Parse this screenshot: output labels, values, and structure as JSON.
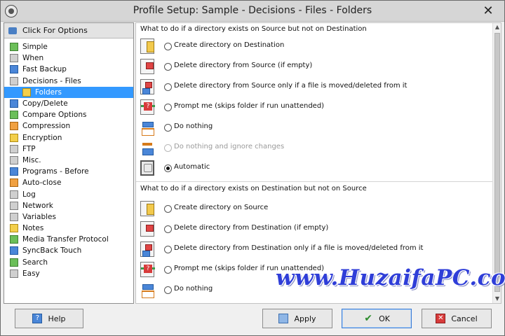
{
  "window": {
    "title": "Profile Setup: Sample - Decisions - Files - Folders",
    "close_glyph": "✕"
  },
  "sidebar": {
    "header": "Click For Options",
    "items": [
      {
        "label": "Simple",
        "icon": "simple-icon",
        "color": "green"
      },
      {
        "label": "When",
        "icon": "clock-icon",
        "color": "gray"
      },
      {
        "label": "Fast Backup",
        "icon": "fast-backup-icon",
        "color": "blue"
      },
      {
        "label": "Decisions - Files",
        "icon": "decisions-icon",
        "color": "gray"
      },
      {
        "label": "Folders",
        "icon": "folder-icon",
        "color": "yellow",
        "selected": true
      },
      {
        "label": "Copy/Delete",
        "icon": "copy-delete-icon",
        "color": "blue"
      },
      {
        "label": "Compare Options",
        "icon": "compare-icon",
        "color": "green"
      },
      {
        "label": "Compression",
        "icon": "compression-icon",
        "color": "orange"
      },
      {
        "label": "Encryption",
        "icon": "lock-icon",
        "color": "yellow"
      },
      {
        "label": "FTP",
        "icon": "ftp-icon",
        "color": "gray"
      },
      {
        "label": "Misc.",
        "icon": "misc-icon",
        "color": "gray"
      },
      {
        "label": "Programs - Before",
        "icon": "programs-icon",
        "color": "blue"
      },
      {
        "label": "Auto-close",
        "icon": "auto-close-icon",
        "color": "orange"
      },
      {
        "label": "Log",
        "icon": "log-icon",
        "color": "gray"
      },
      {
        "label": "Network",
        "icon": "network-icon",
        "color": "gray"
      },
      {
        "label": "Variables",
        "icon": "variables-icon",
        "color": "gray"
      },
      {
        "label": "Notes",
        "icon": "notes-icon",
        "color": "yellow"
      },
      {
        "label": "Media Transfer Protocol",
        "icon": "media-icon",
        "color": "green"
      },
      {
        "label": "SyncBack Touch",
        "icon": "touch-icon",
        "color": "blue"
      },
      {
        "label": "Search",
        "icon": "search-icon",
        "color": "green"
      },
      {
        "label": "Easy",
        "icon": "easy-icon",
        "color": "gray"
      }
    ]
  },
  "section1": {
    "title": "What to do if a directory exists on Source but not on Destination",
    "options": [
      {
        "label": "Create directory on Destination",
        "checked": false,
        "disabled": false,
        "icon": "create-folder-icon"
      },
      {
        "label": "Delete directory from Source (if empty)",
        "checked": false,
        "disabled": false,
        "icon": "delete-folder-icon"
      },
      {
        "label": "Delete directory from Source only if a file is moved/deleted from it",
        "checked": false,
        "disabled": false,
        "icon": "delete-moved-icon"
      },
      {
        "label": "Prompt me (skips folder if run unattended)",
        "checked": false,
        "disabled": false,
        "icon": "prompt-icon"
      },
      {
        "label": "Do nothing",
        "checked": false,
        "disabled": false,
        "icon": "do-nothing-icon"
      },
      {
        "label": "Do nothing and ignore changes",
        "checked": false,
        "disabled": true,
        "icon": "ignore-changes-icon"
      },
      {
        "label": "Automatic",
        "checked": true,
        "disabled": false,
        "icon": "automatic-icon"
      }
    ]
  },
  "section2": {
    "title": "What to do if a directory exists on Destination but not on Source",
    "options": [
      {
        "label": "Create directory on Source",
        "checked": false,
        "disabled": false,
        "icon": "create-folder-icon"
      },
      {
        "label": "Delete directory from Destination (if empty)",
        "checked": false,
        "disabled": false,
        "icon": "delete-folder-icon"
      },
      {
        "label": "Delete directory from Destination only if a file is moved/deleted from it",
        "checked": false,
        "disabled": false,
        "icon": "delete-moved-icon"
      },
      {
        "label": "Prompt me (skips folder if run unattended)",
        "checked": false,
        "disabled": false,
        "icon": "prompt-icon"
      },
      {
        "label": "Do nothing",
        "checked": false,
        "disabled": false,
        "icon": "do-nothing-icon"
      }
    ]
  },
  "buttons": {
    "help": "Help",
    "apply": "Apply",
    "ok": "OK",
    "cancel": "Cancel"
  },
  "watermark": "www.HuzaifaPC.com",
  "colors": {
    "selection": "#3399ff",
    "watermark": "#2f3ed8"
  }
}
